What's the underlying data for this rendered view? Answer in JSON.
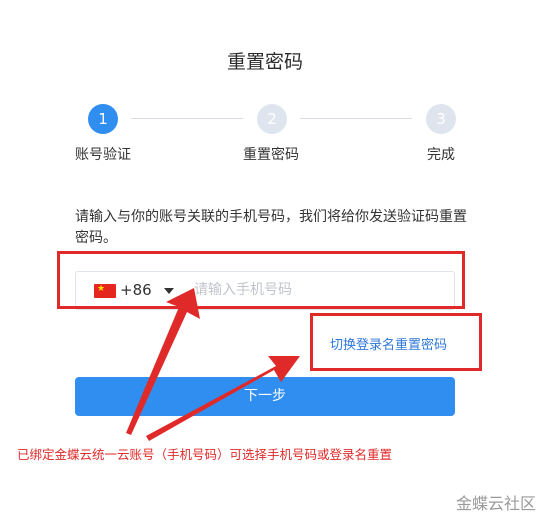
{
  "page": {
    "title": "重置密码"
  },
  "steps": [
    {
      "number": "1",
      "label": "账号验证",
      "state": "active"
    },
    {
      "number": "2",
      "label": "重置密码",
      "state": "inactive"
    },
    {
      "number": "3",
      "label": "完成",
      "state": "inactive"
    }
  ],
  "form": {
    "description": "请输入与你的账号关联的手机号码，我们将给你发送验证码重置密码。",
    "country_code": "+86",
    "country_flag_icon": "china-flag-icon",
    "phone_placeholder": "请输入手机号码",
    "switch_link": "切换登录名重置密码",
    "next_button": "下一步"
  },
  "annotation": {
    "note": "已绑定金蝶云统一云账号（手机号码）可选择手机号码或登录名重置",
    "color": "#e02a2a"
  },
  "watermark": "金蝶云社区",
  "colors": {
    "primary": "#2f8ef0",
    "link": "#2f78d8",
    "step_inactive": "#dfe5ef"
  }
}
